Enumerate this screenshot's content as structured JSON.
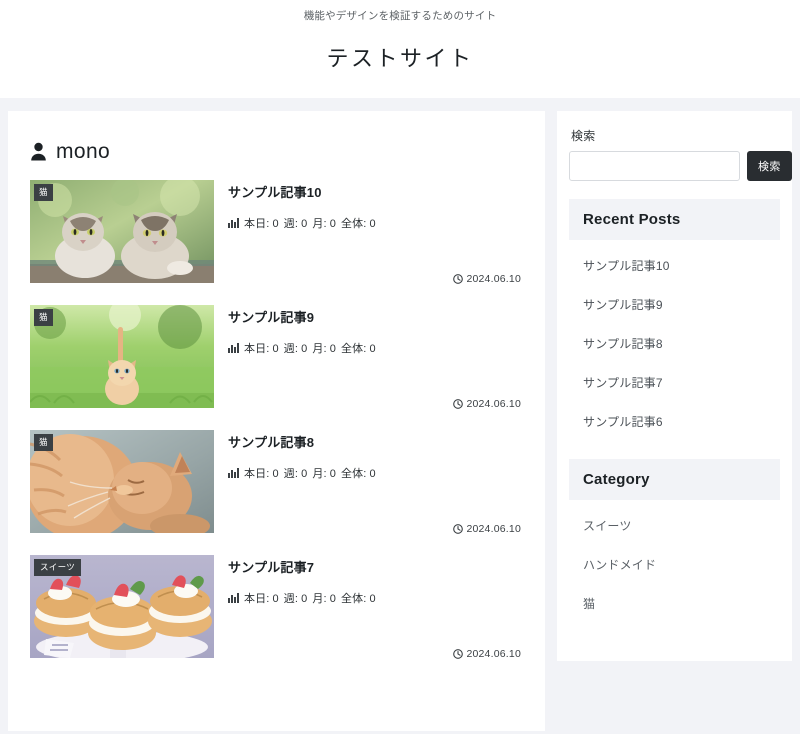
{
  "header": {
    "tagline": "機能やデザインを検証するためのサイト",
    "title": "テストサイト"
  },
  "author": {
    "name": "mono",
    "icon": "person-icon"
  },
  "main": {
    "stat_labels": {
      "today": "本日: 0",
      "week": "週: 0",
      "month": "月: 0",
      "total": "全体: 0"
    },
    "posts": [
      {
        "title": "サンプル記事10",
        "category_badge": "猫",
        "date": "2024.06.10",
        "today": "本日: 0",
        "week": "週: 0",
        "month": "月: 0",
        "total": "全体: 0",
        "thumb": "two-tabby-cats-photo"
      },
      {
        "title": "サンプル記事9",
        "category_badge": "猫",
        "date": "2024.06.10",
        "today": "本日: 0",
        "week": "週: 0",
        "month": "月: 0",
        "total": "全体: 0",
        "thumb": "orange-kitten-grass-photo"
      },
      {
        "title": "サンプル記事8",
        "category_badge": "猫",
        "date": "2024.06.10",
        "today": "本日: 0",
        "week": "週: 0",
        "month": "月: 0",
        "total": "全体: 0",
        "thumb": "fluffy-ginger-cat-photo"
      },
      {
        "title": "サンプル記事7",
        "category_badge": "スイーツ",
        "date": "2024.06.10",
        "today": "本日: 0",
        "week": "週: 0",
        "month": "月: 0",
        "total": "全体: 0",
        "thumb": "cream-puff-strawberry-photo"
      }
    ]
  },
  "sidebar": {
    "search": {
      "label": "検索",
      "value": "",
      "placeholder": "",
      "button": "検索"
    },
    "recent": {
      "heading": "Recent Posts",
      "items": [
        "サンプル記事10",
        "サンプル記事9",
        "サンプル記事8",
        "サンプル記事7",
        "サンプル記事6"
      ]
    },
    "category": {
      "heading": "Category",
      "items": [
        "スイーツ",
        "ハンドメイド",
        "猫"
      ]
    }
  },
  "colors": {
    "page_bg": "#f2f3f7",
    "card_bg": "#ffffff",
    "text": "#24292e",
    "badge_bg": "#3b4044",
    "button_bg": "#292d31"
  }
}
